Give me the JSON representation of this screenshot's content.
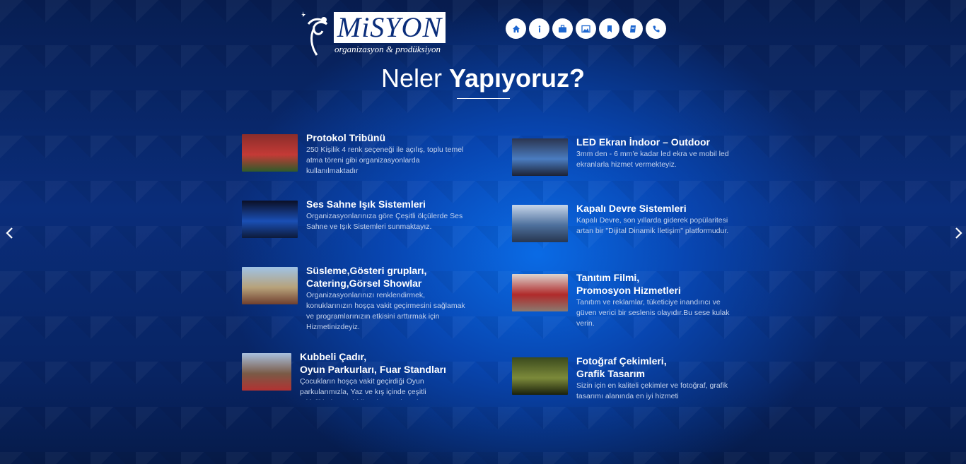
{
  "brand": {
    "name": "MiSYON",
    "tagline": "organizasyon & prodüksiyon"
  },
  "nav": {
    "items": [
      {
        "icon": "home-icon"
      },
      {
        "icon": "info-icon"
      },
      {
        "icon": "briefcase-icon"
      },
      {
        "icon": "image-icon"
      },
      {
        "icon": "bookmark-icon"
      },
      {
        "icon": "book-icon"
      },
      {
        "icon": "phone-icon"
      }
    ]
  },
  "section": {
    "heading_light": "Neler",
    "heading_bold": "Yapıyoruz?"
  },
  "services": [
    {
      "title": "Protokol Tribünü",
      "desc": "250 Kişilik 4 renk seçeneği ile açılış, toplu temel atma töreni gibi organizasyonlarda kullanılmaktadır",
      "thumb_colors": [
        "#8a2d2a",
        "#c43a36",
        "#2f5b2a"
      ]
    },
    {
      "title": "LED Ekran İndoor – Outdoor",
      "desc": "3mm den - 6 mm'e kadar led ekra ve mobil led ekranlarla hizmet vermekteyiz.",
      "thumb_colors": [
        "#2b3550",
        "#4a7cc0",
        "#1c2236"
      ]
    },
    {
      "title": "Ses Sahne Işık Sistemleri",
      "desc": "Organizasyonlarınıza göre Çeşitli ölçülerde Ses Sahne ve Işık Sistemleri sunmaktayız.",
      "thumb_colors": [
        "#0b0f25",
        "#1a4fb5",
        "#0d1a3a"
      ]
    },
    {
      "title": "Kapalı Devre Sistemleri",
      "desc": "Kapalı Devre, son yıllarda giderek popülaritesi artan bir \"Dijital Dinamik İletişim\" platformudur.",
      "thumb_colors": [
        "#c7d6ea",
        "#4d6f9c",
        "#27364f"
      ]
    },
    {
      "title": "Süsleme,Gösteri grupları,\nCatering,Görsel Showlar",
      "desc": "Organizasyonlarınızı renklendirmek, konuklarınızın hoşça vakit geçirmesini sağlamak ve programlarınızın etkisini arttırmak için Hizmetinizdeyiz.",
      "thumb_colors": [
        "#9fc3e6",
        "#b7a27a",
        "#6f3f2e"
      ]
    },
    {
      "title": "Tanıtım Filmi,\nPromosyon Hizmetleri",
      "desc": "Tanıtım ve reklamlar, tüketiciye inandırıcı ve güven verici bir seslenis olayıdır.Bu sese kulak verin.",
      "thumb_colors": [
        "#ddd5cf",
        "#b02a2a",
        "#8a7a70"
      ]
    },
    {
      "title": "Kubbeli Çadır,\nOyun Parkurları, Fuar Standları",
      "desc": "Çocukların hoşça vakit geçirdiği Oyun parkularımızla, Yaz ve kış içinde çeşitli etkinliklerin yapıldığı çok amaçlı çadır",
      "thumb_colors": [
        "#a9c1df",
        "#7a5a46",
        "#b23232"
      ]
    },
    {
      "title": "Fotoğraf Çekimleri,\nGrafik Tasarım",
      "desc": "Sizin için en kaliteli çekimler ve fotoğraf, grafik tasarımı alanında en iyi hizmeti",
      "thumb_colors": [
        "#3b4a1d",
        "#7c8a3a",
        "#1a200c"
      ]
    }
  ],
  "carousel": {
    "prev_icon": "chevron-left-icon",
    "next_icon": "chevron-right-icon"
  }
}
